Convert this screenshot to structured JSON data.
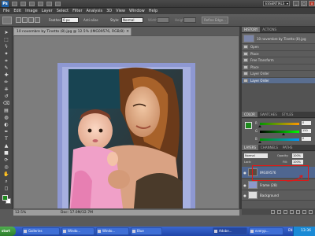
{
  "app": {
    "logo": "Ps",
    "workspace": "ESSENTIALS"
  },
  "window_controls": [
    "_",
    "□",
    "x"
  ],
  "menu": [
    "File",
    "Edit",
    "Image",
    "Layer",
    "Select",
    "Filter",
    "Analysis",
    "3D",
    "View",
    "Window",
    "Help"
  ],
  "options": {
    "feather_label": "Feather:",
    "feather_value": "0 px",
    "antialias_label": "Anti-alias",
    "style_label": "Style:",
    "style_value": "Normal",
    "width_label": "Width:",
    "height_label": "Height:",
    "refine_label": "Refine Edge..."
  },
  "document": {
    "tab_title": "10 novembre by Tinetto (8).jpg @ 12.5% (IMG09576, RGB/8)",
    "tab_close": "×",
    "zoom": "12.5%",
    "info": "Doc: 17.0M/32.7M"
  },
  "tools": [
    "move-tool-icon",
    "marquee-tool-icon",
    "lasso-tool-icon",
    "magic-wand-icon",
    "crop-tool-icon",
    "eyedropper-icon",
    "healing-brush-icon",
    "brush-tool-icon",
    "clone-stamp-icon",
    "history-brush-icon",
    "eraser-icon",
    "gradient-tool-icon",
    "blur-tool-icon",
    "dodge-tool-icon",
    "pen-tool-icon",
    "type-tool-icon",
    "path-select-icon",
    "shape-tool-icon",
    "3d-rotate-icon",
    "3d-orbit-icon",
    "hand-tool-icon",
    "zoom-tool-icon",
    "quick-mask-icon"
  ],
  "colors": {
    "foreground": "#1d8a1d",
    "background": "#ffffff",
    "selection_highlight": "#5a6e90",
    "annotation": "#e01818"
  },
  "history": {
    "tabs": [
      "HISTORY",
      "ACTIONS"
    ],
    "snapshot": "10 novembre by Tinetto (8).jpg",
    "steps": [
      "Open",
      "Place",
      "Free Transform",
      "Place",
      "Layer Order",
      "Layer Order"
    ],
    "selected_index": 5
  },
  "color_panel": {
    "tabs": [
      "COLOR",
      "SWATCHES",
      "STYLES"
    ],
    "sliders": [
      {
        "label": "R",
        "value": "0",
        "level": 0.0
      },
      {
        "label": "G",
        "value": "150",
        "level": 0.59
      },
      {
        "label": "B",
        "value": "0",
        "level": 0.0
      }
    ]
  },
  "layers_panel": {
    "tabs": [
      "LAYERS",
      "CHANNELS",
      "PATHS"
    ],
    "blend_mode": "Normal",
    "opacity_label": "Opacity:",
    "opacity": "100%",
    "lock_label": "Lock:",
    "fill_label": "Fill:",
    "fill": "100%",
    "layers": [
      {
        "name": "IMG09576",
        "selected": true
      },
      {
        "name": "Frame (28)",
        "selected": false
      },
      {
        "name": "Background",
        "selected": false
      }
    ]
  },
  "taskbar": {
    "start": "start",
    "items": [
      "Galleries",
      "Windo...",
      "Windo...",
      "Blue",
      "Adobe...",
      "everyp..."
    ],
    "active_index": 4,
    "lang": "EN",
    "clock": "13:36"
  }
}
